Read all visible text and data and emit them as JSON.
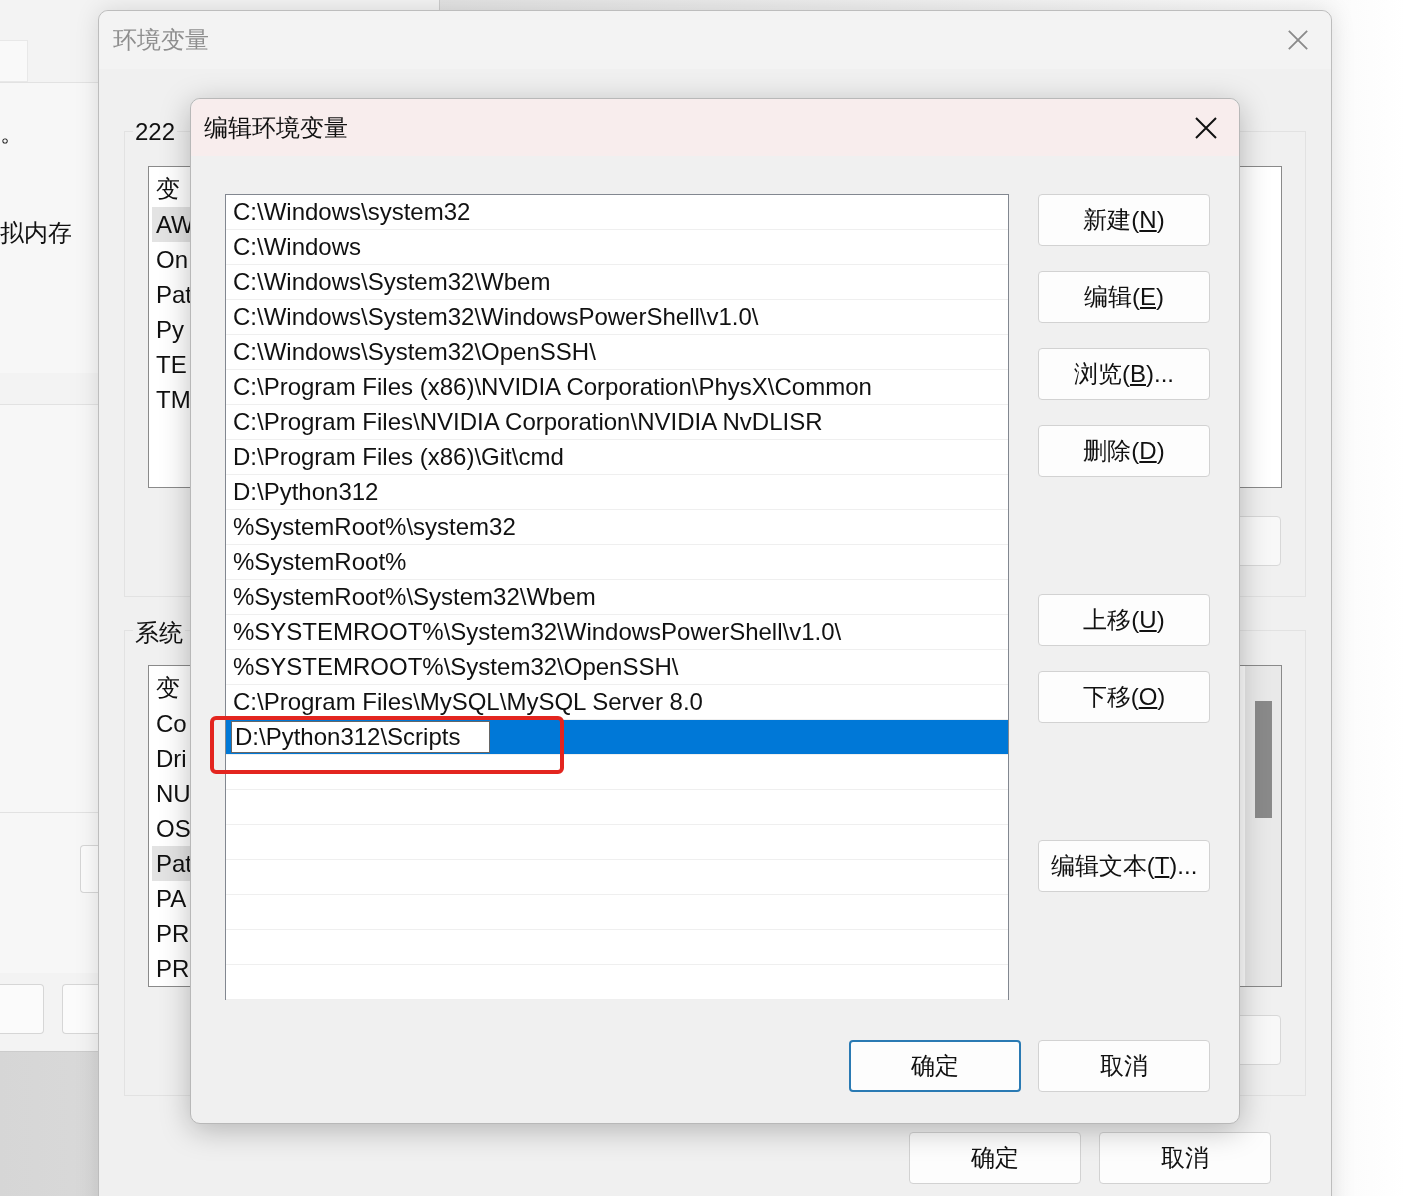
{
  "background_window": {
    "texts": [
      "。",
      "拟内存"
    ]
  },
  "env_window": {
    "title": "环境变量",
    "user_group": {
      "label": "222",
      "header": "变",
      "rows": [
        {
          "name": "AW",
          "selected": true
        },
        {
          "name": "On",
          "selected": false
        },
        {
          "name": "Pat",
          "selected": false
        },
        {
          "name": "Py",
          "selected": false
        },
        {
          "name": "TE",
          "selected": false
        },
        {
          "name": "TM",
          "selected": false
        }
      ]
    },
    "system_group": {
      "label": "系统",
      "header": "变",
      "rows": [
        {
          "name": "Co",
          "selected": false
        },
        {
          "name": "Dri",
          "selected": false
        },
        {
          "name": "NU",
          "selected": false
        },
        {
          "name": "OS",
          "selected": false
        },
        {
          "name": "Pat",
          "selected": true
        },
        {
          "name": "PA",
          "selected": false
        },
        {
          "name": "PR",
          "selected": false
        },
        {
          "name": "PR",
          "selected": false
        }
      ]
    },
    "buttons": [
      {
        "label": "确定",
        "default": false
      },
      {
        "label": "取消",
        "default": false
      }
    ]
  },
  "edit_dialog": {
    "title": "编辑环境变量",
    "paths": [
      {
        "text": "C:\\Windows\\system32",
        "selected": false,
        "editing": false,
        "annotated": false
      },
      {
        "text": "C:\\Windows",
        "selected": false,
        "editing": false,
        "annotated": false
      },
      {
        "text": "C:\\Windows\\System32\\Wbem",
        "selected": false,
        "editing": false,
        "annotated": false
      },
      {
        "text": "C:\\Windows\\System32\\WindowsPowerShell\\v1.0\\",
        "selected": false,
        "editing": false,
        "annotated": false
      },
      {
        "text": "C:\\Windows\\System32\\OpenSSH\\",
        "selected": false,
        "editing": false,
        "annotated": false
      },
      {
        "text": "C:\\Program Files (x86)\\NVIDIA Corporation\\PhysX\\Common",
        "selected": false,
        "editing": false,
        "annotated": false
      },
      {
        "text": "C:\\Program Files\\NVIDIA Corporation\\NVIDIA NvDLISR",
        "selected": false,
        "editing": false,
        "annotated": false
      },
      {
        "text": "D:\\Program Files (x86)\\Git\\cmd",
        "selected": false,
        "editing": false,
        "annotated": false
      },
      {
        "text": "D:\\Python312",
        "selected": false,
        "editing": false,
        "annotated": false
      },
      {
        "text": "%SystemRoot%\\system32",
        "selected": false,
        "editing": false,
        "annotated": false
      },
      {
        "text": "%SystemRoot%",
        "selected": false,
        "editing": false,
        "annotated": false
      },
      {
        "text": "%SystemRoot%\\System32\\Wbem",
        "selected": false,
        "editing": false,
        "annotated": false
      },
      {
        "text": "%SYSTEMROOT%\\System32\\WindowsPowerShell\\v1.0\\",
        "selected": false,
        "editing": false,
        "annotated": false
      },
      {
        "text": "%SYSTEMROOT%\\System32\\OpenSSH\\",
        "selected": false,
        "editing": false,
        "annotated": false
      },
      {
        "text": "C:\\Program Files\\MySQL\\MySQL Server 8.0",
        "selected": false,
        "editing": false,
        "annotated": false
      },
      {
        "text": "D:\\Python312\\Scripts",
        "selected": true,
        "editing": true,
        "annotated": true
      }
    ],
    "button_groups": [
      {
        "buttons": [
          {
            "before": "新建(",
            "key": "N",
            "after": ")"
          },
          {
            "before": "编辑(",
            "key": "E",
            "after": ")"
          },
          {
            "before": "浏览(",
            "key": "B",
            "after": ")..."
          },
          {
            "before": "删除(",
            "key": "D",
            "after": ")"
          }
        ]
      },
      {
        "buttons": [
          {
            "before": "上移(",
            "key": "U",
            "after": ")"
          },
          {
            "before": "下移(",
            "key": "O",
            "after": ")"
          }
        ]
      },
      {
        "buttons": [
          {
            "before": "编辑文本(",
            "key": "T",
            "after": ")..."
          }
        ]
      }
    ],
    "buttons": [
      {
        "label": "确定",
        "default": true
      },
      {
        "label": "取消",
        "default": false
      }
    ]
  }
}
